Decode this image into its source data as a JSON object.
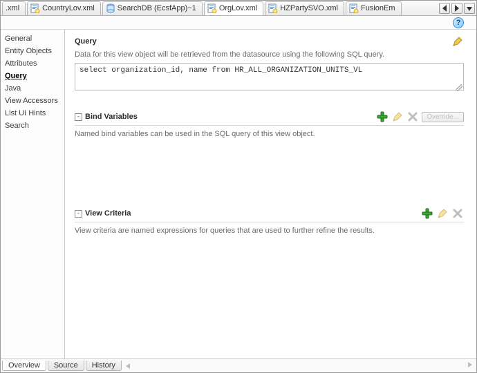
{
  "tabs": [
    {
      "label": ".xml"
    },
    {
      "label": "CountryLov.xml"
    },
    {
      "label": "SearchDB (EcsfApp)~1"
    },
    {
      "label": "OrgLov.xml",
      "active": true
    },
    {
      "label": "HZPartySVO.xml"
    },
    {
      "label": "FusionEm"
    }
  ],
  "help_glyph": "?",
  "sidebar": {
    "items": [
      {
        "label": "General"
      },
      {
        "label": "Entity Objects"
      },
      {
        "label": "Attributes"
      },
      {
        "label": "Query",
        "selected": true
      },
      {
        "label": "Java"
      },
      {
        "label": "View Accessors"
      },
      {
        "label": "List UI Hints"
      },
      {
        "label": "Search"
      }
    ]
  },
  "query": {
    "title": "Query",
    "desc": "Data for this view object will be retrieved from the datasource using the following SQL query.",
    "sql": "select organization_id, name from HR_ALL_ORGANIZATION_UNITS_VL"
  },
  "bind": {
    "title": "Bind Variables",
    "expander": "-",
    "desc": "Named bind variables can be used in the SQL query of this view object.",
    "override_label": "Override..."
  },
  "criteria": {
    "title": "View Criteria",
    "expander": "-",
    "desc": "View criteria are named expressions for queries that are used to further refine the results."
  },
  "bottom_tabs": [
    {
      "label": "Overview",
      "active": true
    },
    {
      "label": "Source"
    },
    {
      "label": "History"
    }
  ]
}
